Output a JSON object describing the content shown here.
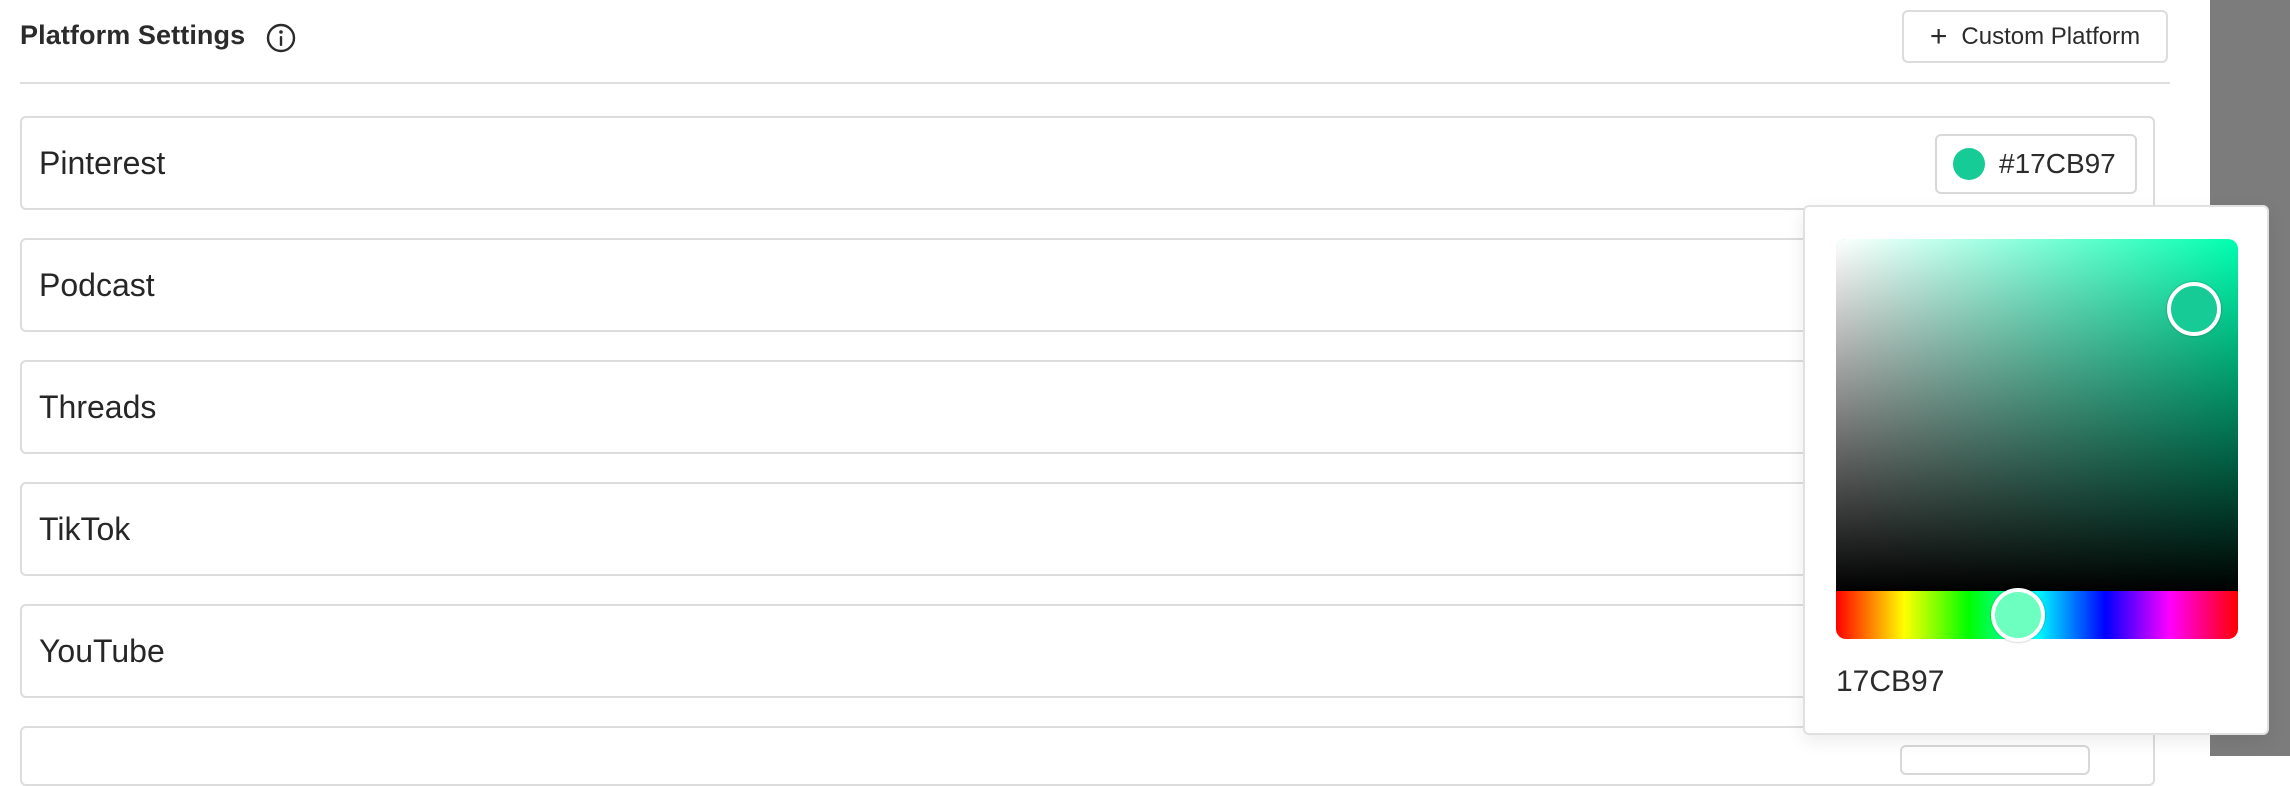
{
  "header": {
    "title": "Platform Settings",
    "info_icon": "info-circle-icon",
    "custom_button_icon": "plus-icon",
    "custom_button_label": "Custom Platform"
  },
  "platforms": [
    {
      "name": "Pinterest"
    },
    {
      "name": "Podcast"
    },
    {
      "name": "Threads"
    },
    {
      "name": "TikTok"
    },
    {
      "name": "YouTube"
    }
  ],
  "selected_color": {
    "hex_label": "#17CB97",
    "swatch_color": "#17CB97"
  },
  "color_picker": {
    "hue_color": "#00FFB0",
    "hue_handle_color": "#6DFFC0",
    "hue_fraction": 0.453,
    "saturation": 0.89,
    "value": 0.8,
    "hex_value": "17CB97"
  }
}
